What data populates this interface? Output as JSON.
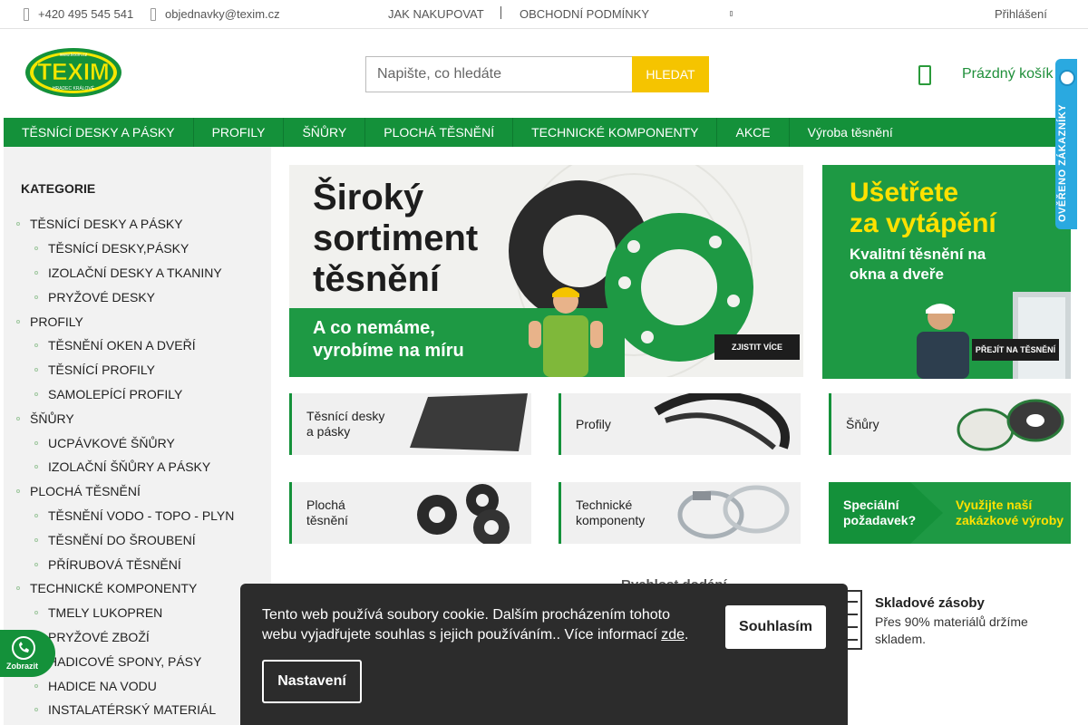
{
  "topbar": {
    "phone": "+420 495 545 541",
    "email": "objednavky@texim.cz",
    "link_how_to_buy": "JAK NAKUPOVAT",
    "link_terms": "OBCHODNÍ PODMÍNKY",
    "login": "Přihlášení"
  },
  "header": {
    "logo_text": "TEXIM",
    "logo_top": "www.texim.cz",
    "logo_bottom": "HRADEC KRÁLOVÉ",
    "search_placeholder": "Napište, co hledáte",
    "search_button": "HLEDAT",
    "cart_label": "Prázdný košík"
  },
  "nav": {
    "items": [
      "TĚSNÍCÍ DESKY A PÁSKY",
      "PROFILY",
      "ŠŇŮRY",
      "PLOCHÁ TĚSNĚNÍ",
      "TECHNICKÉ KOMPONENTY",
      "AKCE",
      "Výroba těsnění"
    ]
  },
  "sidebar": {
    "title": "KATEGORIE",
    "items": [
      {
        "label": "TĚSNÍCÍ DESKY A PÁSKY",
        "level": 1
      },
      {
        "label": "TĚSNÍCÍ DESKY,PÁSKY",
        "level": 2
      },
      {
        "label": "IZOLAČNÍ DESKY A TKANINY",
        "level": 2
      },
      {
        "label": "PRYŽOVÉ DESKY",
        "level": 2
      },
      {
        "label": "PROFILY",
        "level": 1
      },
      {
        "label": "TĚSNĚNÍ OKEN A DVEŘÍ",
        "level": 2
      },
      {
        "label": "TĚSNÍCÍ PROFILY",
        "level": 2
      },
      {
        "label": "SAMOLEPÍCÍ PROFILY",
        "level": 2
      },
      {
        "label": "ŠŇŮRY",
        "level": 1
      },
      {
        "label": "UCPÁVKOVÉ ŠŇŮRY",
        "level": 2
      },
      {
        "label": "IZOLAČNÍ ŠŇŮRY A PÁSKY",
        "level": 2
      },
      {
        "label": "PLOCHÁ TĚSNĚNÍ",
        "level": 1
      },
      {
        "label": "TĚSNĚNÍ VODO - TOPO - PLYN",
        "level": 2
      },
      {
        "label": "TĚSNĚNÍ DO ŠROUBENÍ",
        "level": 2
      },
      {
        "label": "PŘÍRUBOVÁ TĚSNĚNÍ",
        "level": 2
      },
      {
        "label": "TECHNICKÉ KOMPONENTY",
        "level": 1
      },
      {
        "label": "TMELY LUKOPREN",
        "level": 2
      },
      {
        "label": "PRYŽOVÉ ZBOŽÍ",
        "level": 2
      },
      {
        "label": "HADICOVÉ SPONY, PÁSY",
        "level": 2
      },
      {
        "label": "HADICE NA VODU",
        "level": 2
      },
      {
        "label": "INSTALATÉRSKÝ MATERIÁL",
        "level": 2
      }
    ]
  },
  "banner_main": {
    "headline_1": "Široký",
    "headline_2": "sortiment",
    "headline_3": "těsnění",
    "band_1": "A co nemáme,",
    "band_2": "vyrobíme na míru",
    "cta": "ZJISTIT VÍCE"
  },
  "banner_side": {
    "headline_1": "Ušetřete",
    "headline_2": "za vytápění",
    "sub_1": "Kvalitní těsnění na",
    "sub_2": "okna a dveře",
    "cta": "PŘEJÍT NA TĚSNĚNÍ"
  },
  "tiles": {
    "t1_line1": "Těsnící desky",
    "t1_line2": "a pásky",
    "t2": "Profily",
    "t3": "Šňůry",
    "t4_line1": "Plochá",
    "t4_line2": "těsnění",
    "t5_line1": "Technické",
    "t5_line2": "komponenty",
    "t6_line1": "Speciální",
    "t6_line2": "požadavek?",
    "t6_right1": "Využijte naší",
    "t6_right2": "zakázkové výroby"
  },
  "benefits": {
    "b1_title": "Rychlost dodání",
    "b2_title": "Skladové zásoby",
    "b2_text": "Přes 90% materiálů držíme skladem."
  },
  "badge": {
    "text": "OVĚŘENO ZÁKAZNÍKY"
  },
  "chat": {
    "label": "Zobrazit"
  },
  "cookie": {
    "text": "Tento web používá soubory cookie. Dalším procházením tohoto webu vyjadřujete souhlas s jejich používáním.. Více informací",
    "link": "zde",
    "after": ".",
    "agree": "Souhlasím",
    "settings": "Nastavení"
  },
  "colors": {
    "brand_green": "#14913a",
    "banner_green": "#1e9944",
    "accent_yellow": "#f5c400",
    "badge_blue": "#2aa9e0"
  }
}
